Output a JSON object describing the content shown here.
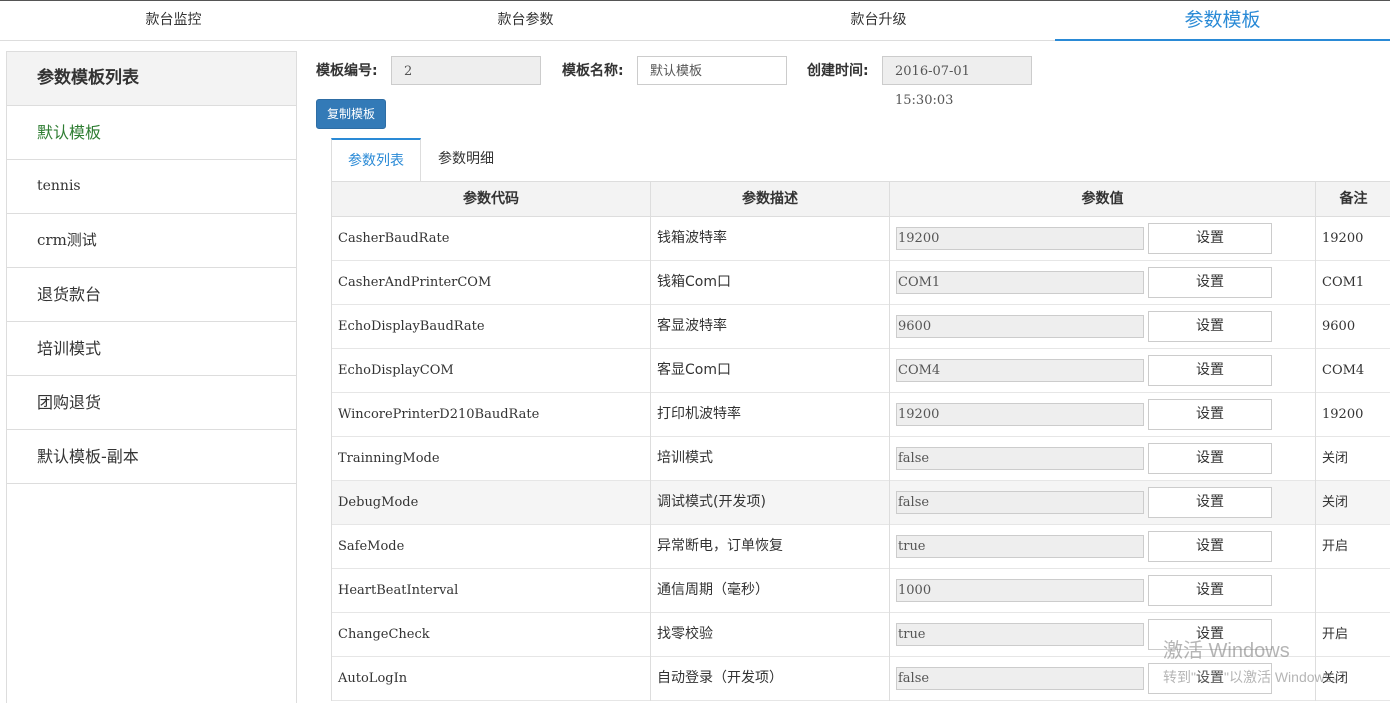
{
  "top_tabs": [
    {
      "label": "款台监控",
      "active": false
    },
    {
      "label": "款台参数",
      "active": false
    },
    {
      "label": "款台升级",
      "active": false
    },
    {
      "label": "参数模板",
      "active": true
    }
  ],
  "sidebar": {
    "title": "参数模板列表",
    "items": [
      {
        "label": "默认模板",
        "active": true
      },
      {
        "label": "tennis",
        "active": false
      },
      {
        "label": "crm测试",
        "active": false
      },
      {
        "label": "退货款台",
        "active": false
      },
      {
        "label": "培训模式",
        "active": false
      },
      {
        "label": "团购退货",
        "active": false
      },
      {
        "label": "默认模板-副本",
        "active": false
      }
    ]
  },
  "form": {
    "template_no_label": "模板编号:",
    "template_no_value": "2",
    "template_name_label": "模板名称:",
    "template_name_value": "默认模板",
    "created_label": "创建时间:",
    "created_value": "2016-07-01 15:30:03",
    "copy_button": "复制模板"
  },
  "sub_tabs": [
    {
      "label": "参数列表",
      "active": true
    },
    {
      "label": "参数明细",
      "active": false
    }
  ],
  "table": {
    "headers": [
      "参数代码",
      "参数描述",
      "参数值",
      "备注"
    ],
    "set_label": "设置",
    "rows": [
      {
        "code": "CasherBaudRate",
        "desc": "钱箱波特率",
        "value": "19200",
        "remark": "19200"
      },
      {
        "code": "CasherAndPrinterCOM",
        "desc": "钱箱Com口",
        "value": "COM1",
        "remark": "COM1"
      },
      {
        "code": "EchoDisplayBaudRate",
        "desc": "客显波特率",
        "value": "9600",
        "remark": "9600"
      },
      {
        "code": "EchoDisplayCOM",
        "desc": "客显Com口",
        "value": "COM4",
        "remark": "COM4"
      },
      {
        "code": "WincorePrinterD210BaudRate",
        "desc": "打印机波特率",
        "value": "19200",
        "remark": "19200"
      },
      {
        "code": "TrainningMode",
        "desc": "培训模式",
        "value": "false",
        "remark": "关闭"
      },
      {
        "code": "DebugMode",
        "desc": "调试模式(开发项)",
        "value": "false",
        "remark": "关闭"
      },
      {
        "code": "SafeMode",
        "desc": "异常断电，订单恢复",
        "value": "true",
        "remark": "开启"
      },
      {
        "code": "HeartBeatInterval",
        "desc": "通信周期（毫秒）",
        "value": "1000",
        "remark": ""
      },
      {
        "code": "ChangeCheck",
        "desc": "找零校验",
        "value": "true",
        "remark": "开启"
      },
      {
        "code": "AutoLogIn",
        "desc": "自动登录（开发项）",
        "value": "false",
        "remark": "关闭"
      }
    ]
  },
  "watermark": {
    "line1": "激活 Windows",
    "line2": "转到\"设置\"以激活 Windows。"
  },
  "colors": {
    "accent": "#2a8ad6",
    "primary_button": "#337ab7",
    "active_sidebar": "#2e7d32"
  }
}
